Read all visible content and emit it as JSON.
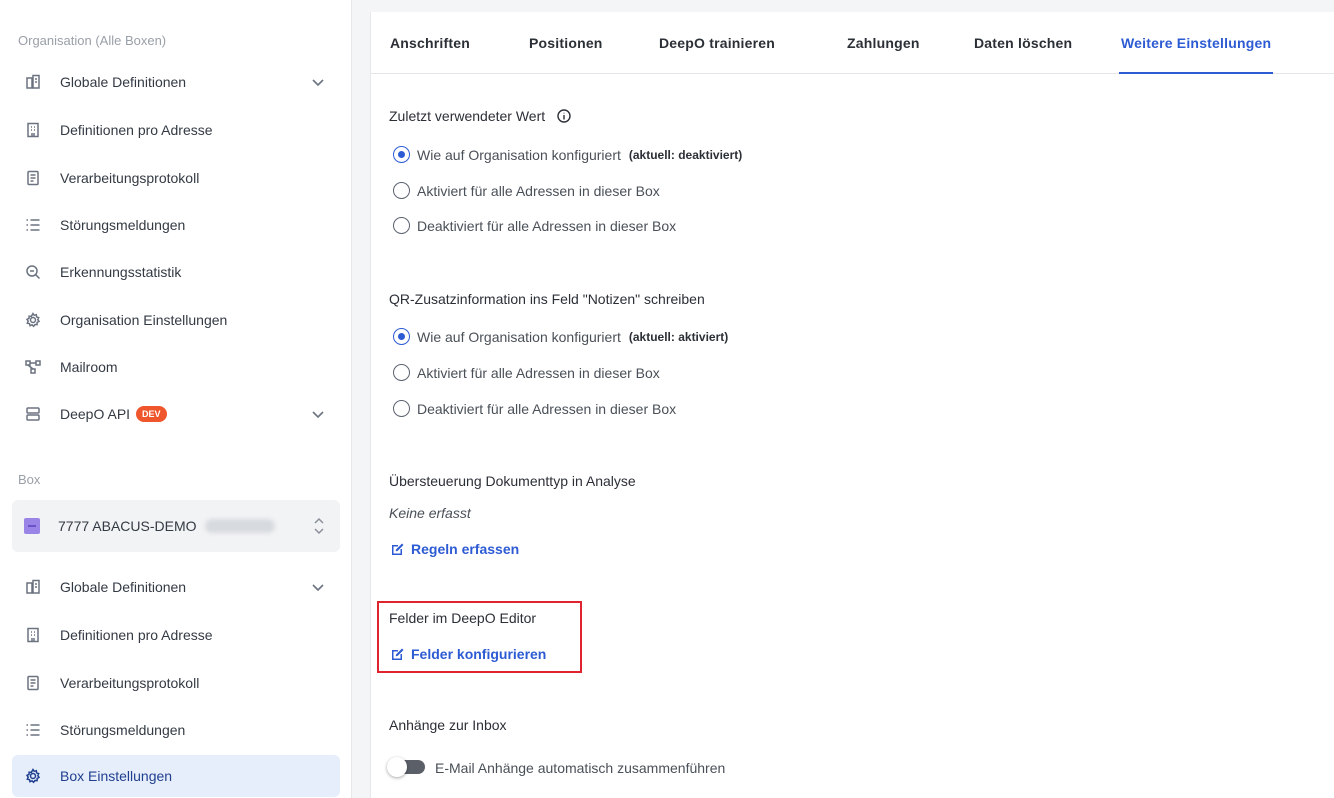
{
  "sidebar": {
    "org_section_label": "Organisation (Alle Boxen)",
    "org_items": [
      {
        "label": "Globale Definitionen",
        "icon": "building-icon",
        "has_chevron": true
      },
      {
        "label": "Definitionen pro Adresse",
        "icon": "building-grid-icon"
      },
      {
        "label": "Verarbeitungsprotokoll",
        "icon": "document-icon"
      },
      {
        "label": "Störungsmeldungen",
        "icon": "list-icon"
      },
      {
        "label": "Erkennungsstatistik",
        "icon": "zoom-icon"
      },
      {
        "label": "Organisation Einstellungen",
        "icon": "gear-icon"
      },
      {
        "label": "Mailroom",
        "icon": "flow-icon"
      },
      {
        "label": "DeepO API",
        "icon": "server-icon",
        "badge": "DEV",
        "has_chevron": true
      }
    ],
    "box_section_label": "Box",
    "box_select": {
      "label": "7777 ABACUS-DEMO"
    },
    "box_items": [
      {
        "label": "Globale Definitionen",
        "icon": "building-icon",
        "has_chevron": true
      },
      {
        "label": "Definitionen pro Adresse",
        "icon": "building-grid-icon"
      },
      {
        "label": "Verarbeitungsprotokoll",
        "icon": "document-icon"
      },
      {
        "label": "Störungsmeldungen",
        "icon": "list-icon"
      },
      {
        "label": "Box Einstellungen",
        "icon": "gear-icon",
        "active": true
      }
    ]
  },
  "tabs": [
    {
      "label": "Anschriften"
    },
    {
      "label": "Positionen"
    },
    {
      "label": "DeepO trainieren"
    },
    {
      "label": "Zahlungen"
    },
    {
      "label": "Daten löschen"
    },
    {
      "label": "Weitere Einstellungen",
      "active": true
    }
  ],
  "settings": {
    "last_value": {
      "heading": "Zuletzt verwendeter Wert",
      "options": [
        {
          "label": "Wie auf Organisation konfiguriert",
          "note": "(aktuell: deaktiviert)",
          "checked": true
        },
        {
          "label": "Aktiviert für alle Adressen in dieser Box",
          "checked": false
        },
        {
          "label": "Deaktiviert für alle Adressen in dieser Box",
          "checked": false
        }
      ]
    },
    "qr_info": {
      "heading": "QR-Zusatzinformation ins Feld \"Notizen\" schreiben",
      "options": [
        {
          "label": "Wie auf Organisation konfiguriert",
          "note": "(aktuell: aktiviert)",
          "checked": true
        },
        {
          "label": "Aktiviert für alle Adressen in dieser Box",
          "checked": false
        },
        {
          "label": "Deaktiviert für alle Adressen in dieser Box",
          "checked": false
        }
      ]
    },
    "doc_type_override": {
      "heading": "Übersteuerung Dokumenttyp in Analyse",
      "empty_text": "Keine erfasst",
      "link_label": "Regeln erfassen"
    },
    "editor_fields": {
      "heading": "Felder im DeepO Editor",
      "link_label": "Felder konfigurieren"
    },
    "attachments": {
      "heading": "Anhänge zur Inbox",
      "toggle_label": "E-Mail Anhänge automatisch zusammenführen",
      "toggle_on": false
    }
  },
  "colors": {
    "accent": "#2d5bd3",
    "highlight_border": "#e0242f",
    "badge": "#f0562c"
  }
}
